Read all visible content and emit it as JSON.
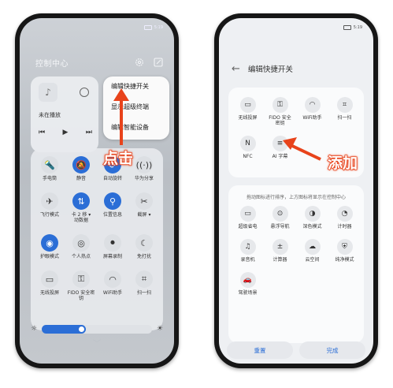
{
  "left_phone": {
    "status": {
      "line1": "",
      "line2": "",
      "time": "5:19"
    },
    "header": {
      "title": "控制中心",
      "settings_icon": "gear-icon",
      "edit_icon": "edit-icon"
    },
    "music": {
      "status": "未在播放"
    },
    "menu": {
      "items": [
        "编辑快捷开关",
        "显示超级终端",
        "编辑智能设备"
      ]
    },
    "toggles": [
      {
        "label": "手电筒",
        "icon": "🔦",
        "on": false
      },
      {
        "label": "静音",
        "icon": "🔕",
        "on": true
      },
      {
        "label": "自动旋转",
        "icon": "⟳",
        "on": true
      },
      {
        "label": "华为分享",
        "icon": "((·))",
        "on": false
      },
      {
        "label": "飞行模式",
        "icon": "✈",
        "on": false
      },
      {
        "label": "卡 2 移 ▾\n动数据",
        "icon": "⇅",
        "on": true
      },
      {
        "label": "位置信息",
        "icon": "⚲",
        "on": true
      },
      {
        "label": "截屏 ▾",
        "icon": "✂",
        "on": false
      },
      {
        "label": "护眼模式",
        "icon": "◉",
        "on": true
      },
      {
        "label": "个人热点",
        "icon": "◎",
        "on": false
      },
      {
        "label": "屏幕录制",
        "icon": "⏺",
        "on": false
      },
      {
        "label": "免打扰",
        "icon": "☾",
        "on": false
      },
      {
        "label": "无线投屏",
        "icon": "▭",
        "on": false
      },
      {
        "label": "FIDO 安全密钥",
        "icon": "⚿",
        "on": false
      },
      {
        "label": "WiFi助手",
        "icon": "◠",
        "on": false
      },
      {
        "label": "扫一扫",
        "icon": "⌗",
        "on": false
      }
    ],
    "brightness": {
      "level": 0.4
    },
    "annotation": "点击"
  },
  "right_phone": {
    "status": {
      "time": "5:19"
    },
    "header": {
      "title": "编辑快捷开关"
    },
    "active_tiles": [
      {
        "label": "无线投屏",
        "icon": "▭"
      },
      {
        "label": "FIDO 安全\n密钥",
        "icon": "⚿"
      },
      {
        "label": "WiFi助手",
        "icon": "◠"
      },
      {
        "label": "扫一扫",
        "icon": "⌗"
      },
      {
        "label": "NFC",
        "icon": "N"
      },
      {
        "label": "AI 字幕",
        "icon": "≡"
      }
    ],
    "hint": "拖动图标进行排序，上方图标将显示在控制中心",
    "available_tiles": [
      {
        "label": "超级省电",
        "icon": "▭"
      },
      {
        "label": "悬浮导航",
        "icon": "⊙"
      },
      {
        "label": "深色模式",
        "icon": "◑"
      },
      {
        "label": "计时器",
        "icon": "◔"
      },
      {
        "label": "录音机",
        "icon": "♫"
      },
      {
        "label": "计算器",
        "icon": "±"
      },
      {
        "label": "云空间",
        "icon": "☁"
      },
      {
        "label": "纯净模式",
        "icon": "⛨"
      },
      {
        "label": "驾驶场景",
        "icon": "🚗"
      }
    ],
    "buttons": {
      "reset": "重置",
      "done": "完成"
    },
    "annotation": "添加"
  },
  "colors": {
    "accent": "#2b6ed6",
    "annotation": "#e8431b"
  }
}
